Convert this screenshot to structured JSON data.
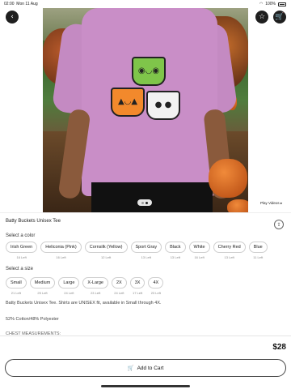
{
  "status": {
    "time": "02:00",
    "date": "Mon 11 Aug",
    "battery": "100%"
  },
  "hero": {
    "back_icon": "chevron-left-icon",
    "favorite_icon": "star-icon",
    "cart_icon": "shopping-cart-icon",
    "image_count": 2,
    "active_image": 1,
    "play_videos": "Play Videos"
  },
  "product": {
    "title": "Batty Buckets Unisex Tee",
    "share_icon": "share-icon"
  },
  "colors": {
    "label": "Select a color",
    "options": [
      {
        "name": "Irish Green",
        "stock": "16 Left"
      },
      {
        "name": "Heliconia (Pink)",
        "stock": "16 Left"
      },
      {
        "name": "Cornsilk (Yellow)",
        "stock": "12 Left"
      },
      {
        "name": "Sport Gray",
        "stock": "13 Left"
      },
      {
        "name": "Black",
        "stock": "13 Left"
      },
      {
        "name": "White",
        "stock": "16 Left"
      },
      {
        "name": "Cherry Red",
        "stock": "13 Left"
      },
      {
        "name": "Blue",
        "stock": "11 Left"
      }
    ]
  },
  "sizes": {
    "label": "Select a size",
    "options": [
      {
        "name": "Small",
        "stock": "21 Left"
      },
      {
        "name": "Medium",
        "stock": "25 Left"
      },
      {
        "name": "Large",
        "stock": "24 Left"
      },
      {
        "name": "X-Large",
        "stock": "23 Left"
      },
      {
        "name": "2X",
        "stock": "24 Left"
      },
      {
        "name": "3X",
        "stock": "17 Left"
      },
      {
        "name": "4X",
        "stock": "23 Left"
      }
    ]
  },
  "description": {
    "line1": "Batty Buckets Unisex Tee. Shirts are UNISEX fit, available in Small through 4X.",
    "line2": "52% Cotton/48% Polyester",
    "line3": "CHEST MEASUREMENTS:"
  },
  "cart": {
    "price": "$28",
    "add_label": "Add to Cart",
    "add_icon": "cart-icon"
  }
}
